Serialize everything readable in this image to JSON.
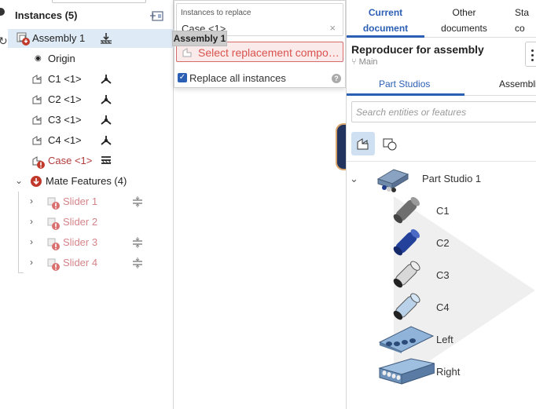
{
  "tree": {
    "title": "Instances (5)",
    "rows": {
      "assembly": "Assembly 1",
      "origin": "Origin",
      "c1": "C1 <1>",
      "c2": "C2 <1>",
      "c3": "C3 <1>",
      "c4": "C4 <1>",
      "case": "Case <1>",
      "mates": "Mate Features (4)",
      "slider1": "Slider 1",
      "slider2": "Slider 2",
      "slider3": "Slider 3",
      "slider4": "Slider 4"
    }
  },
  "dialog": {
    "field_label": "Instances to replace",
    "field_value": "Case <1>",
    "select_placeholder": "Select replacement compo…",
    "checkbox_label": "Replace all instances",
    "checkbox_checked": true
  },
  "tooltip": "Assembly 1",
  "insert": {
    "tabs": {
      "current_line1": "Current",
      "current_line2": "document",
      "other_line1": "Other",
      "other_line2": "documents",
      "third_line1": "Sta",
      "third_line2": "co"
    },
    "doc_title": "Reproducer for assembly",
    "branch": "Main",
    "subtabs": {
      "part_studios": "Part Studios",
      "assemblies": "Assembli"
    },
    "search_placeholder": "Search entities or features",
    "part_studio": "Part Studio 1",
    "parts": [
      "C1",
      "C2",
      "C3",
      "C4",
      "Left",
      "Right"
    ]
  },
  "colors": {
    "accent": "#2b5fb4",
    "error": "#b03a3a",
    "selection": "#deebf7",
    "warning_bg": "#fbeaea"
  }
}
